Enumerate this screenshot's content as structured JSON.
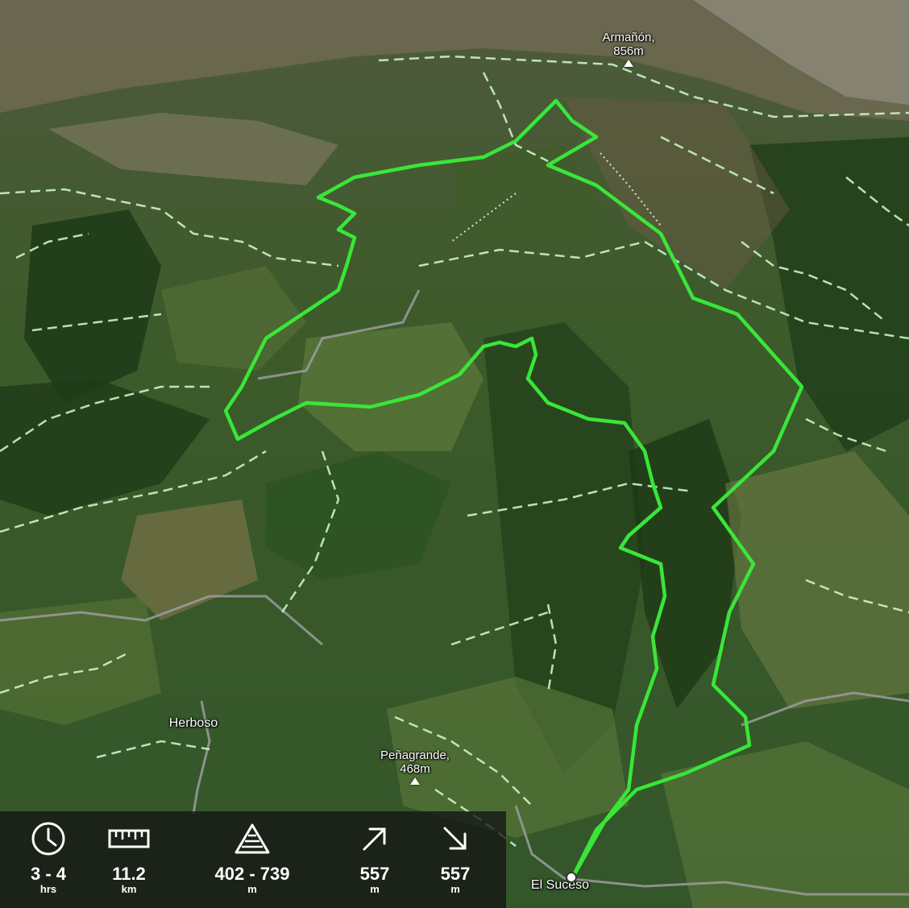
{
  "map": {
    "places": [
      {
        "id": "armanon",
        "name": "Armañón,",
        "elev": "856m",
        "kind": "peak"
      },
      {
        "id": "penagrande",
        "name": "Peñagrande,",
        "elev": "468m",
        "kind": "peak"
      },
      {
        "id": "herboso",
        "name": "Herboso",
        "kind": "village"
      },
      {
        "id": "el-suceso",
        "name": "El Suceso",
        "kind": "start"
      }
    ],
    "route_color": "#39e639",
    "trail_color": "#c9f5c4"
  },
  "stats": {
    "duration": {
      "icon": "clock-icon",
      "value": "3 - 4",
      "unit": "hrs"
    },
    "distance": {
      "icon": "ruler-icon",
      "value": "11.2",
      "unit": "km"
    },
    "elevation": {
      "icon": "mountain-icon",
      "value": "402 - 739",
      "unit": "m"
    },
    "ascent": {
      "icon": "arrow-up-right-icon",
      "value": "557",
      "unit": "m"
    },
    "descent": {
      "icon": "arrow-down-right-icon",
      "value": "557",
      "unit": "m"
    }
  }
}
